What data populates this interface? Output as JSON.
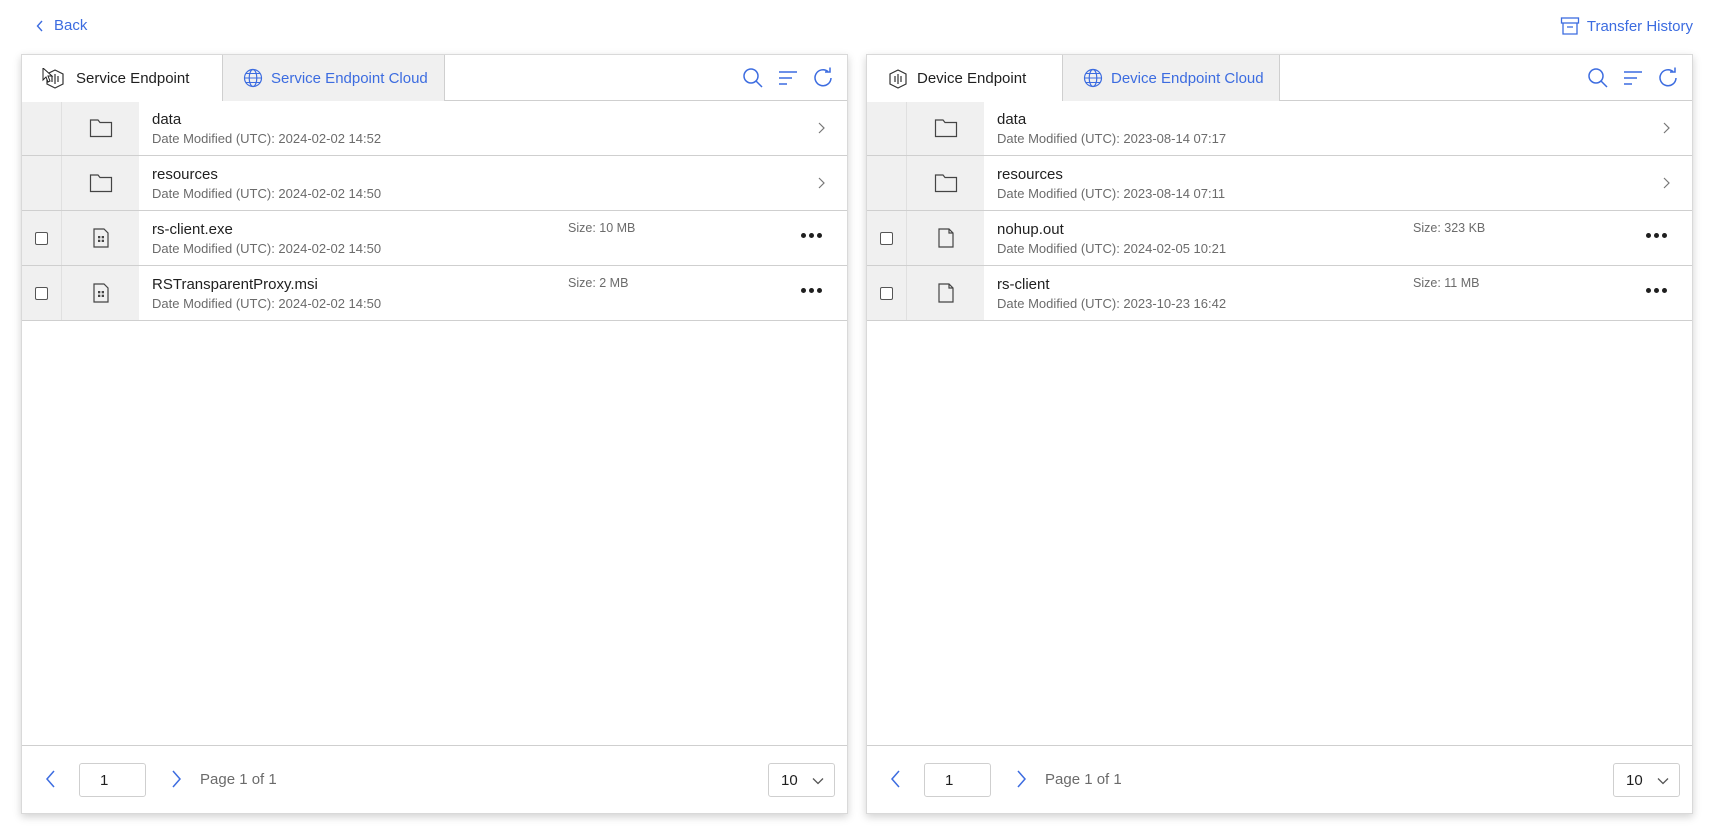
{
  "header": {
    "back_label": "Back",
    "transfer_history_label": "Transfer History"
  },
  "colors": {
    "accent": "#3c6ce0",
    "tab_inactive_bg": "#f0f0f0",
    "muted_text": "#6b6b6b"
  },
  "left_panel": {
    "tabs": [
      {
        "label": "Service Endpoint",
        "icon": "service-endpoint-icon",
        "active": true
      },
      {
        "label": "Service Endpoint Cloud",
        "icon": "globe-icon",
        "active": false
      }
    ],
    "rows": [
      {
        "type": "folder",
        "name": "data",
        "date": "Date Modified (UTC): 2024-02-02 14:52",
        "size": ""
      },
      {
        "type": "folder",
        "name": "resources",
        "date": "Date Modified (UTC): 2024-02-02 14:50",
        "size": ""
      },
      {
        "type": "file",
        "name": "rs-client.exe",
        "date": "Date Modified (UTC): 2024-02-02 14:50",
        "size": "Size: 10 MB"
      },
      {
        "type": "file",
        "name": "RSTransparentProxy.msi",
        "date": "Date Modified (UTC): 2024-02-02 14:50",
        "size": "Size: 2 MB"
      }
    ],
    "pagination": {
      "page_value": "1",
      "page_label": "Page 1 of 1",
      "page_size": "10"
    }
  },
  "right_panel": {
    "tabs": [
      {
        "label": "Device Endpoint",
        "icon": "device-endpoint-icon",
        "active": true
      },
      {
        "label": "Device Endpoint Cloud",
        "icon": "globe-icon",
        "active": false
      }
    ],
    "rows": [
      {
        "type": "folder",
        "name": "data",
        "date": "Date Modified (UTC): 2023-08-14 07:17",
        "size": ""
      },
      {
        "type": "folder",
        "name": "resources",
        "date": "Date Modified (UTC): 2023-08-14 07:11",
        "size": ""
      },
      {
        "type": "file",
        "name": "nohup.out",
        "date": "Date Modified (UTC): 2024-02-05 10:21",
        "size": "Size: 323 KB"
      },
      {
        "type": "file",
        "name": "rs-client",
        "date": "Date Modified (UTC): 2023-10-23 16:42",
        "size": "Size: 11 MB"
      }
    ],
    "pagination": {
      "page_value": "1",
      "page_label": "Page 1 of 1",
      "page_size": "10"
    }
  }
}
